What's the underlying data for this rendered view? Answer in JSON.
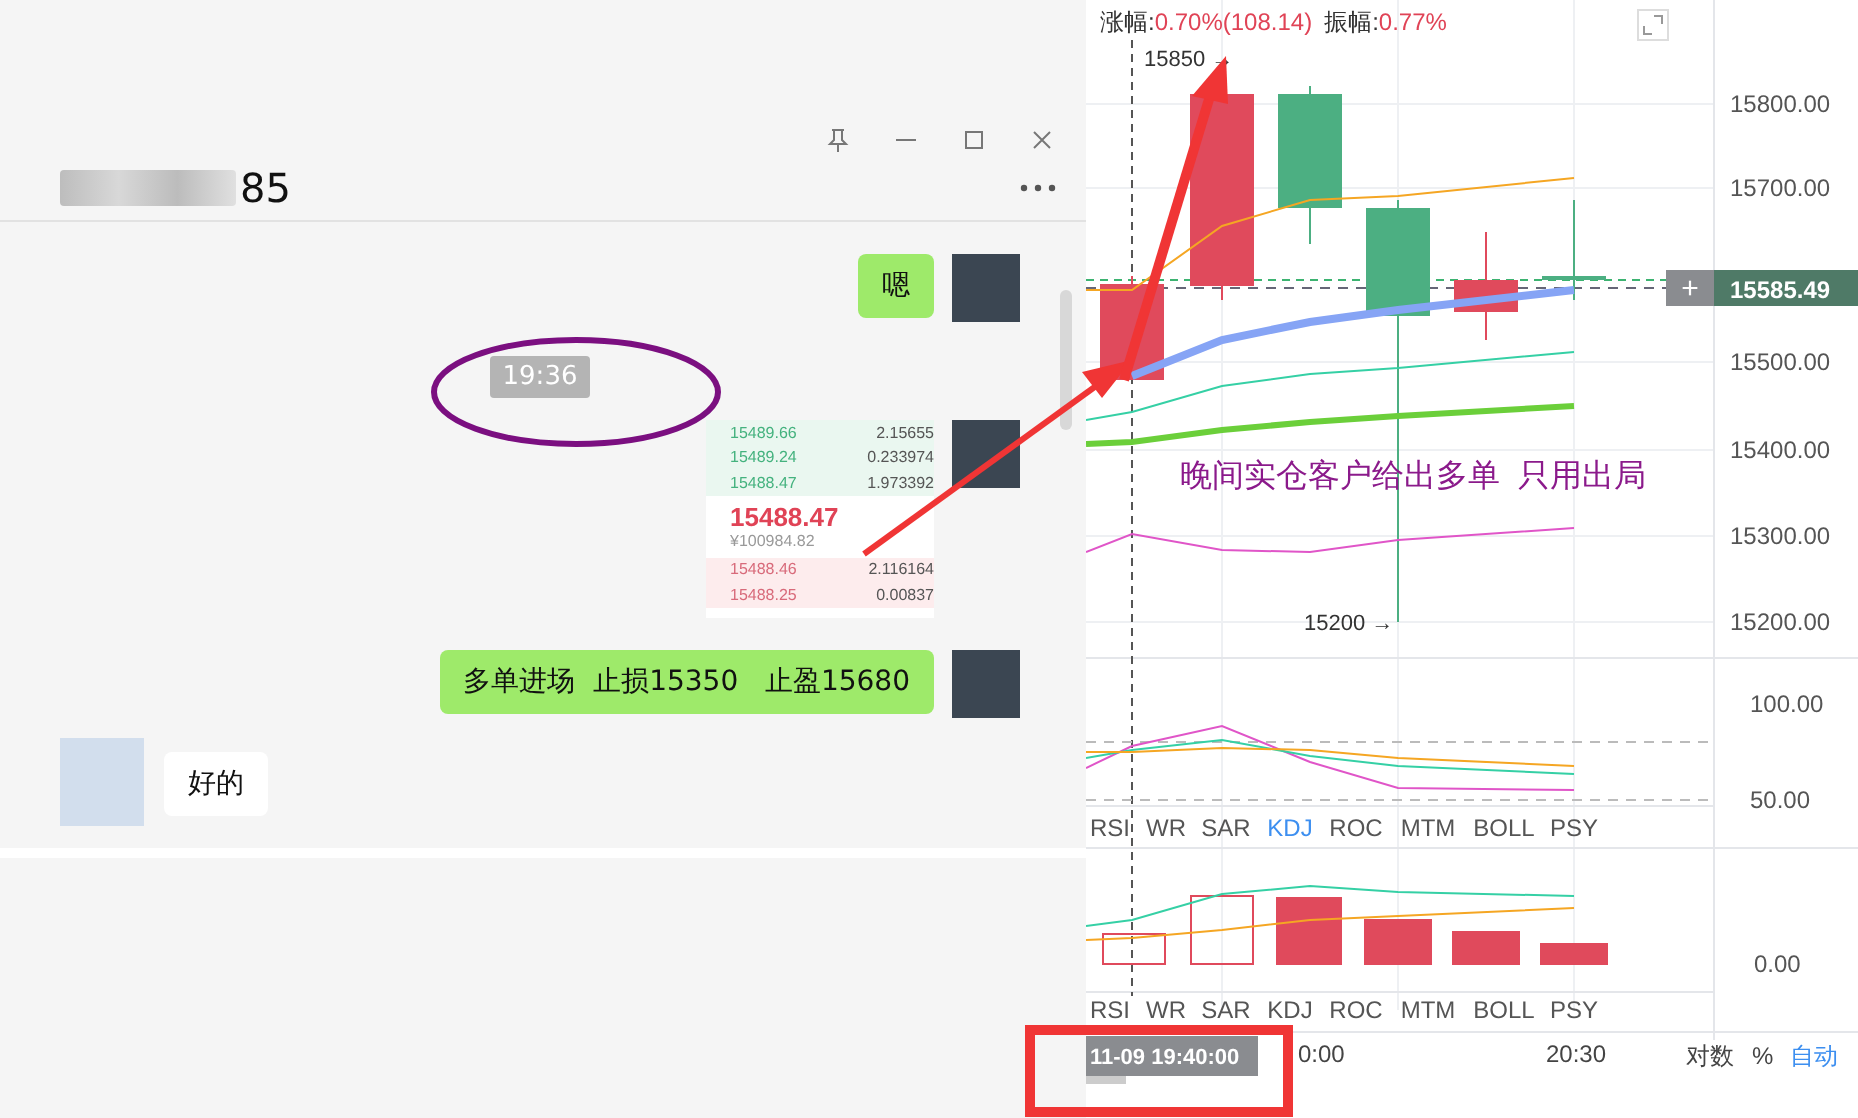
{
  "chat": {
    "title_suffix": "85",
    "messages": [
      {
        "kind": "sent",
        "text": "嗯"
      },
      {
        "kind": "time",
        "text": "19:36"
      },
      {
        "kind": "orderbook",
        "asks": [
          {
            "price": "15489.66",
            "amount": "2.15655"
          },
          {
            "price": "15489.24",
            "amount": "0.233974"
          },
          {
            "price": "15488.47",
            "amount": "1.973392"
          }
        ],
        "last_price": "15488.47",
        "cny": "¥100984.82",
        "bids": [
          {
            "price": "15488.46",
            "amount": "2.116164"
          },
          {
            "price": "15488.25",
            "amount": "0.00837"
          }
        ]
      },
      {
        "kind": "sent",
        "text": "多单进场  止损15350   止盈15680"
      },
      {
        "kind": "received",
        "text": "好的"
      },
      {
        "kind": "cut"
      }
    ]
  },
  "chart": {
    "change_label": "涨幅:",
    "change_value": "0.70%(108.14)",
    "amplitude_label": "振幅:",
    "amplitude_value": "0.77%",
    "high_marker": "15850 →",
    "low_marker": "15200 →",
    "price_axis": [
      "15800.00",
      "15700.00",
      "15500.00",
      "15400.00",
      "15300.00",
      "15200.00"
    ],
    "last_price": "15585.49",
    "plus": "+",
    "indicator_axis": [
      "100.00",
      "50.00"
    ],
    "tabs": [
      {
        "label": "RSI",
        "selected": false
      },
      {
        "label": "WR",
        "selected": false
      },
      {
        "label": "SAR",
        "selected": false
      },
      {
        "label": "KDJ",
        "selected": true
      },
      {
        "label": "ROC",
        "selected": false
      },
      {
        "label": "MTM",
        "selected": false
      },
      {
        "label": "BOLL",
        "selected": false
      },
      {
        "label": "PSY",
        "selected": false
      }
    ],
    "macd_axis": [
      "0.00"
    ],
    "tabs_lower": [
      {
        "label": "RSI",
        "selected": false
      },
      {
        "label": "WR",
        "selected": false
      },
      {
        "label": "SAR",
        "selected": false
      },
      {
        "label": "KDJ",
        "selected": false
      },
      {
        "label": "ROC",
        "selected": false
      },
      {
        "label": "MTM",
        "selected": false
      },
      {
        "label": "BOLL",
        "selected": false
      },
      {
        "label": "PSY",
        "selected": false
      }
    ],
    "crosshair_time": "11-09 19:40:00",
    "time_labels": [
      "0:00",
      "20:30"
    ],
    "scale_options": [
      {
        "label": "对数",
        "selected": false
      },
      {
        "label": "%",
        "selected": false
      },
      {
        "label": "自动",
        "selected": true
      }
    ],
    "note": "晚间实仓客户给出多单  只用出局"
  }
}
